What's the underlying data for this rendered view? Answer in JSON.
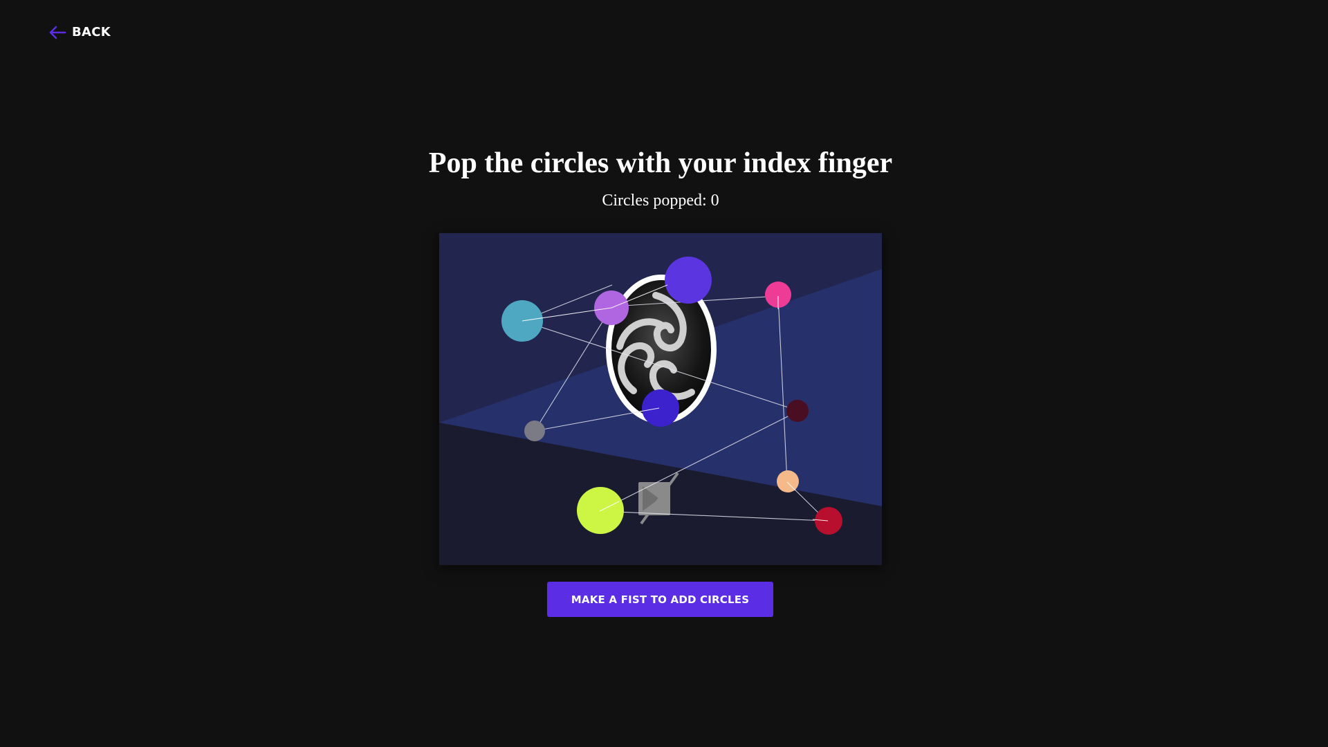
{
  "nav": {
    "back_label": "BACK"
  },
  "main": {
    "title": "Pop the circles with your index finger",
    "counter_label": "Circles popped:",
    "counter_value": "0"
  },
  "action": {
    "button_label": "MAKE A FIST TO ADD CIRCLES"
  },
  "colors": {
    "background": "#111111",
    "accent": "#5b2ee6",
    "stage_dark": "#1b1b30",
    "stage_band": "#26306a"
  },
  "icons": {
    "back": "arrow-left-icon",
    "camera_off": "video-camera-off-icon",
    "logo": "obs-logo"
  },
  "circles": [
    {
      "id": "teal",
      "color": "#4fa8c2"
    },
    {
      "id": "lilac",
      "color": "#b066e0"
    },
    {
      "id": "violet-top",
      "color": "#5a35e0"
    },
    {
      "id": "pink",
      "color": "#ee3b96"
    },
    {
      "id": "indigo",
      "color": "#3b22cc"
    },
    {
      "id": "grey",
      "color": "#7b7b86"
    },
    {
      "id": "maroon",
      "color": "#4a0e22"
    },
    {
      "id": "peach",
      "color": "#f5b98a"
    },
    {
      "id": "lime",
      "color": "#ccf544"
    },
    {
      "id": "crimson",
      "color": "#b80f2e"
    }
  ]
}
